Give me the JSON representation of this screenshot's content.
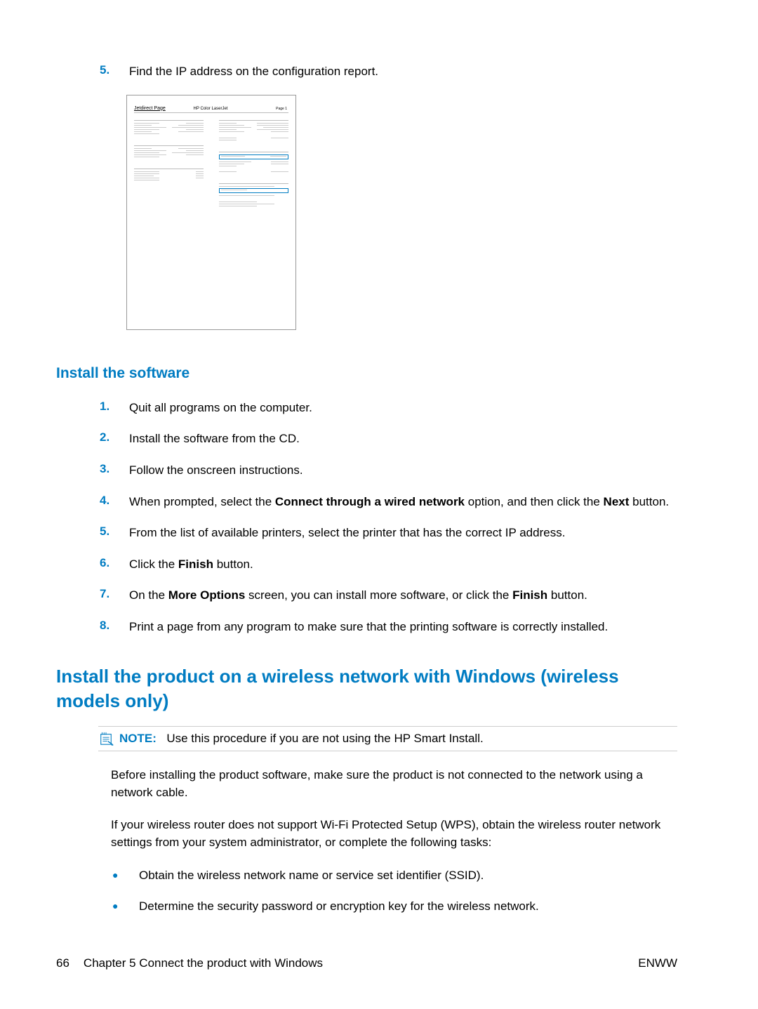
{
  "top_list": [
    {
      "num": "5.",
      "text": "Find the IP address on the configuration report."
    }
  ],
  "jetdirect": {
    "title": "Jetdirect Page",
    "model": "HP Color LaserJet",
    "page": "Page 1"
  },
  "h3_install_software": "Install the software",
  "install_list": [
    {
      "num": "1.",
      "text": "Quit all programs on the computer."
    },
    {
      "num": "2.",
      "text": "Install the software from the CD."
    },
    {
      "num": "3.",
      "text": "Follow the onscreen instructions."
    },
    {
      "num": "4.",
      "parts": [
        "When prompted, select the ",
        "Connect through a wired network",
        " option, and then click the ",
        "Next",
        " button."
      ]
    },
    {
      "num": "5.",
      "text": "From the list of available printers, select the printer that has the correct IP address."
    },
    {
      "num": "6.",
      "parts": [
        "Click the ",
        "Finish",
        " button."
      ]
    },
    {
      "num": "7.",
      "parts": [
        "On the ",
        "More Options",
        " screen, you can install more software, or click the ",
        "Finish",
        " button."
      ]
    },
    {
      "num": "8.",
      "text": "Print a page from any program to make sure that the printing software is correctly installed."
    }
  ],
  "h2_wireless": "Install the product on a wireless network with Windows (wireless models only)",
  "note": {
    "label": "NOTE:",
    "text": "Use this procedure if you are not using the HP Smart Install."
  },
  "para1": "Before installing the product software, make sure the product is not connected to the network using a network cable.",
  "para2": "If your wireless router does not support Wi-Fi Protected Setup (WPS), obtain the wireless router network settings from your system administrator, or complete the following tasks:",
  "bullets": [
    "Obtain the wireless network name or service set identifier (SSID).",
    "Determine the security password or encryption key for the wireless network."
  ],
  "footer": {
    "page": "66",
    "chapter": "Chapter 5   Connect the product with Windows",
    "right": "ENWW"
  }
}
